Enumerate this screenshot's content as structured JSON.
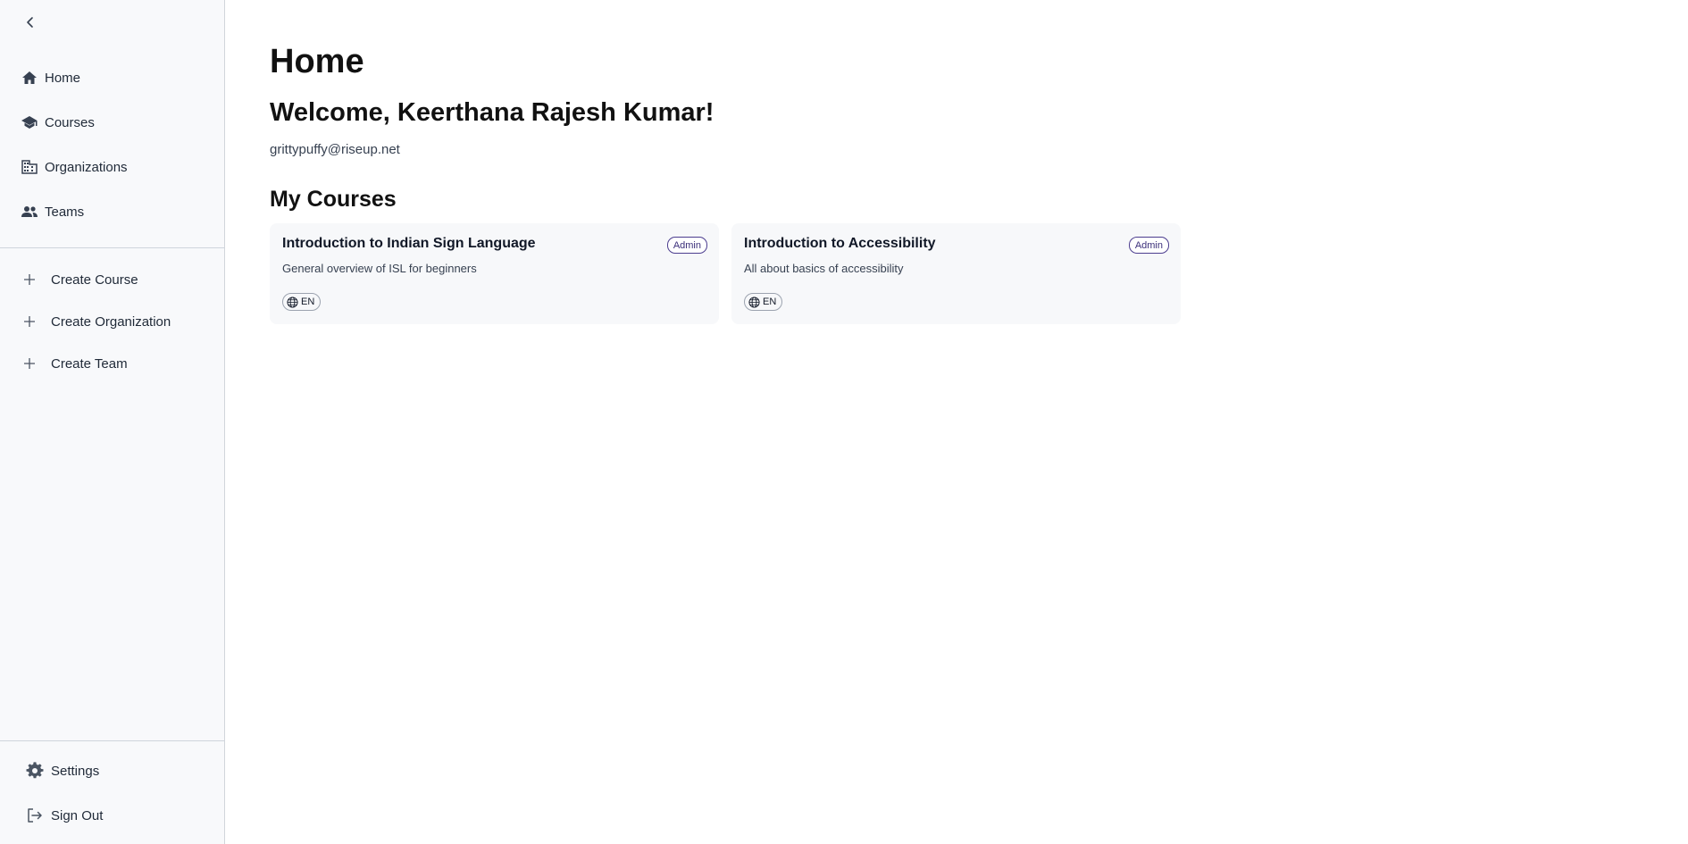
{
  "sidebar": {
    "nav": [
      {
        "label": "Home",
        "icon": "home-icon"
      },
      {
        "label": "Courses",
        "icon": "graduation-cap-icon"
      },
      {
        "label": "Organizations",
        "icon": "building-icon"
      },
      {
        "label": "Teams",
        "icon": "people-icon"
      }
    ],
    "create": [
      {
        "label": "Create Course",
        "icon": "plus-icon"
      },
      {
        "label": "Create Organization",
        "icon": "plus-icon"
      },
      {
        "label": "Create Team",
        "icon": "plus-icon"
      }
    ],
    "bottom": [
      {
        "label": "Settings",
        "icon": "gear-icon"
      },
      {
        "label": "Sign Out",
        "icon": "sign-out-icon"
      }
    ]
  },
  "main": {
    "title": "Home",
    "welcome": "Welcome, Keerthana Rajesh Kumar!",
    "email": "grittypuffy@riseup.net",
    "courses_heading": "My Courses",
    "courses": [
      {
        "title": "Introduction to Indian Sign Language",
        "description": "General overview of ISL for beginners",
        "role": "Admin",
        "language": "EN"
      },
      {
        "title": "Introduction to Accessibility",
        "description": "All about basics of accessibility",
        "role": "Admin",
        "language": "EN"
      }
    ]
  },
  "colors": {
    "sidebar_bg": "#f8f9fb",
    "card_bg": "#f7f8fa",
    "badge_border": "#4c3d8f",
    "text_primary": "#111827"
  }
}
